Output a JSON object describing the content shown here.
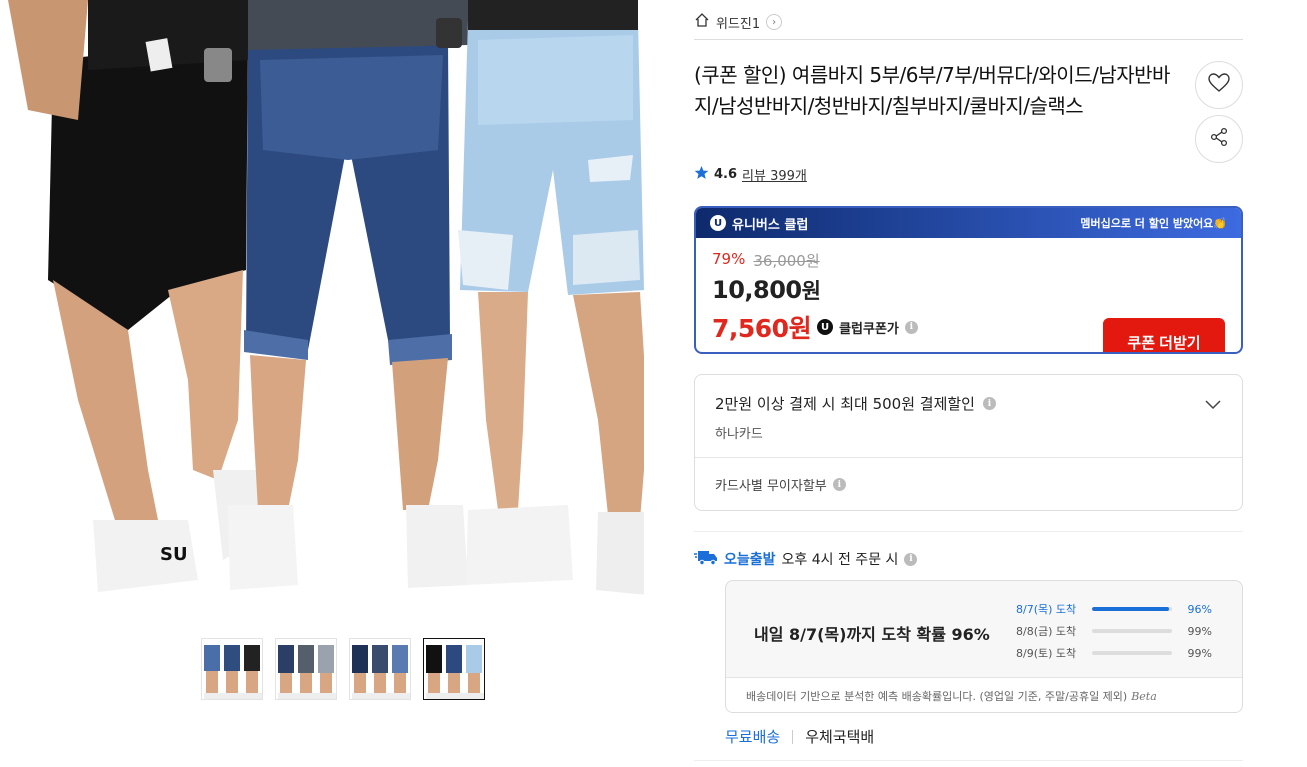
{
  "store": {
    "name": "위드진1"
  },
  "product": {
    "title": "(쿠폰 할인) 여름바지 5부/6부/7부/버뮤다/와이드/남자반바지/남성반바지/청반바지/칠부바지/쿨바지/슬랙스",
    "rating": "4.6",
    "review_label": "리뷰 399개"
  },
  "club": {
    "name": "유니버스 클럽",
    "promo": "멤버십으로 더 할인 받았어요👏",
    "discount_pct": "79%",
    "original_price": "36,000원",
    "price_num": "10,800",
    "price_unit": "원",
    "club_price": "7,560원",
    "club_price_label": "클럽쿠폰가",
    "coupon_button": "쿠폰 더받기"
  },
  "card": {
    "discount_text": "2만원 이상 결제 시 최대 500원 결제할인",
    "card_name": "하나카드",
    "installment": "카드사별 무이자할부"
  },
  "delivery": {
    "today_label": "오늘출발",
    "today_cond": "오후 4시 전 주문 시",
    "headline": "내일 8/7(목)까지 도착 확률 96%",
    "probabilities": [
      {
        "date": "8/7(목) 도착",
        "value": "96%",
        "fraction": 0.96
      },
      {
        "date": "8/8(금) 도착",
        "value": "99%",
        "fraction": 0.0
      },
      {
        "date": "8/9(토) 도착",
        "value": "99%",
        "fraction": 0.0
      }
    ],
    "footnote": "배송데이터 기반으로 분석한 예측 배송확률입니다. (영업일 기준, 주말/공휴일 제외)",
    "beta": "Beta",
    "free": "무료배송",
    "carrier": "우체국택배"
  },
  "colors": {
    "accent": "#e3180f",
    "blue": "#1a6fd8",
    "club_border": "#3b5fc0"
  },
  "thumbnails": {
    "count": 4,
    "selected_index": 3
  }
}
